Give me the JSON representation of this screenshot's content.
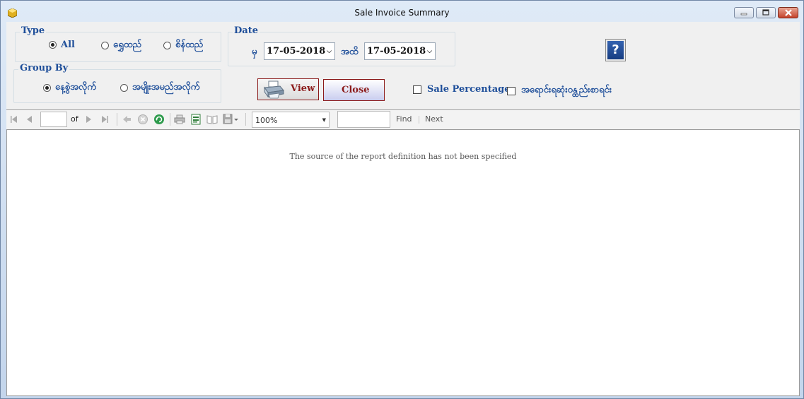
{
  "window": {
    "title": "Sale Invoice Summary",
    "controls": {
      "minimize": "minimize-icon",
      "maximize": "maximize-icon",
      "close": "close-icon"
    }
  },
  "type_group": {
    "legend": "Type",
    "options": [
      {
        "label": "All",
        "selected": true
      },
      {
        "label": "ရွှေထည်",
        "selected": false
      },
      {
        "label": "စိန်ထည်",
        "selected": false
      }
    ]
  },
  "date_group": {
    "legend": "Date",
    "from_label": "မှ",
    "from_value": "17-05-2018",
    "to_label": "အထိ",
    "to_value": "17-05-2018"
  },
  "group_by": {
    "legend": "Group By",
    "options": [
      {
        "label": "နေ့စွဲအလိုက်",
        "selected": true
      },
      {
        "label": "အမျိုးအမည်အလိုက်",
        "selected": false
      }
    ]
  },
  "buttons": {
    "view": "View",
    "close": "Close",
    "help": "?"
  },
  "checkboxes": [
    {
      "label": "Sale Percentage",
      "checked": false
    },
    {
      "label": "အရောင်းရဆုံးဝန္ထည်းစာရင်း",
      "checked": false
    }
  ],
  "report_toolbar": {
    "page_value": "",
    "of_label": "of",
    "zoom": "100%",
    "find_value": "",
    "find_label": "Find",
    "next_label": "Next"
  },
  "report": {
    "message": "The source of the report definition has not been specified"
  },
  "colors": {
    "label_blue": "#1f4f9a",
    "button_red": "#8b1a1a",
    "frame_blue": "#c7d7ea"
  }
}
